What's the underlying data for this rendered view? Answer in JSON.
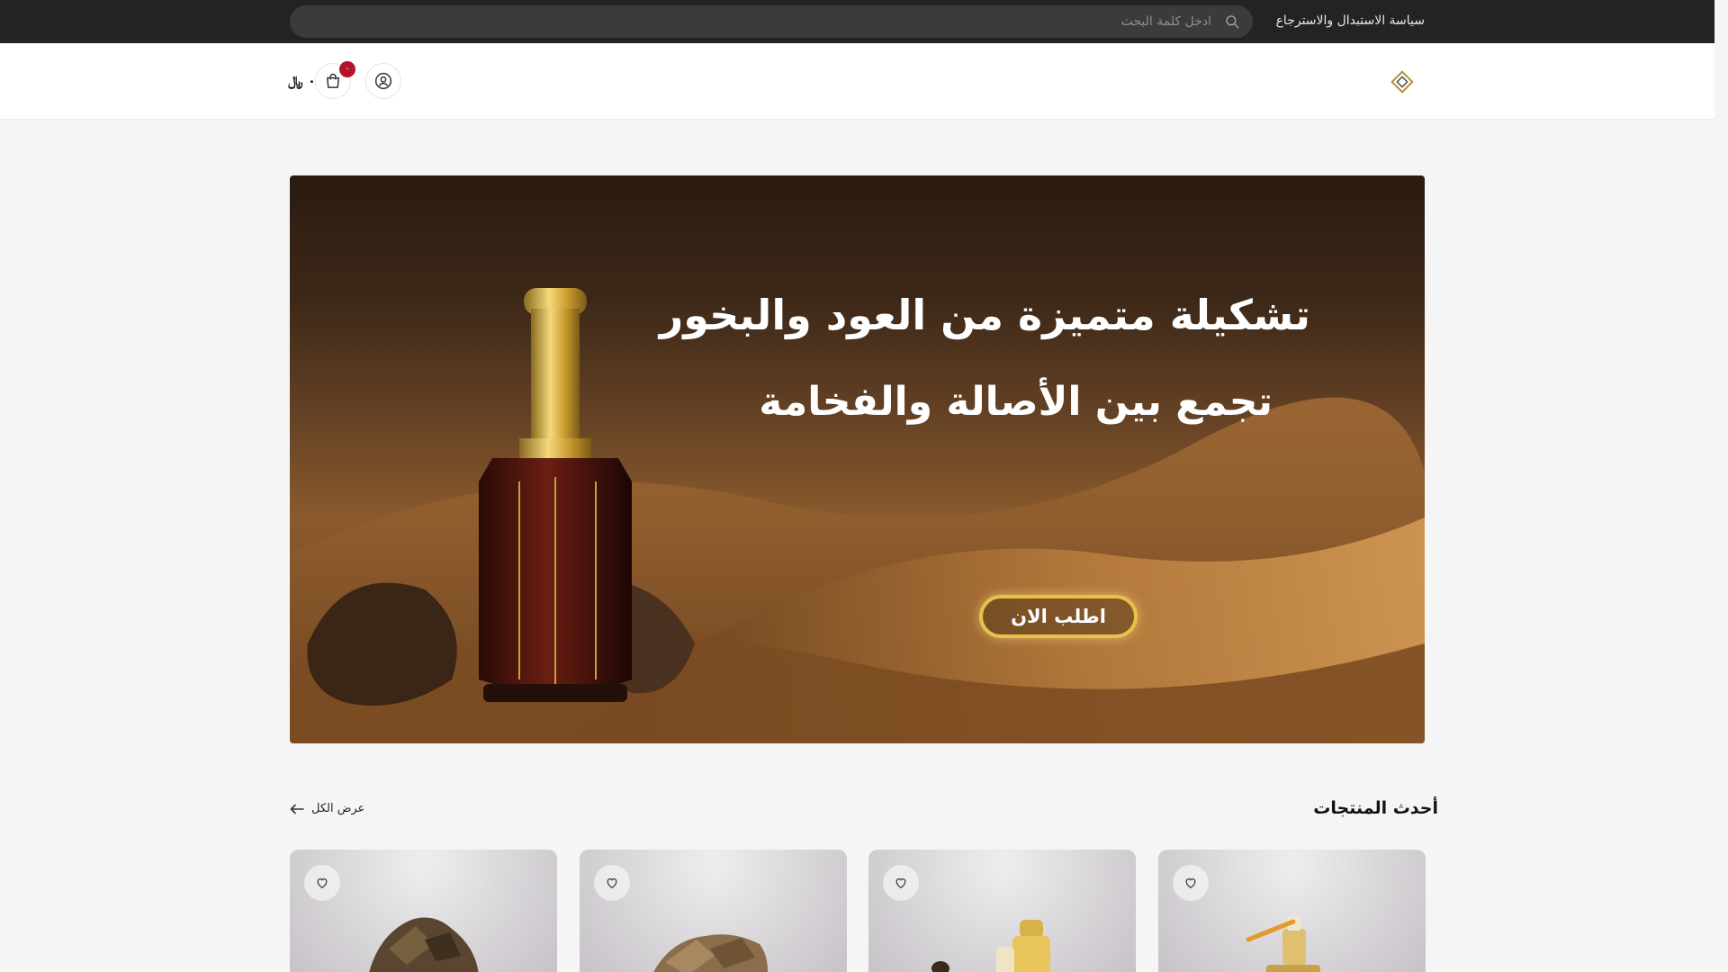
{
  "topbar": {
    "policy_link": "سياسة الاستبدال والاسترجاع",
    "search_placeholder": "ادخل كلمة البحث"
  },
  "header": {
    "cart_count": "٠",
    "cart_total": "٠ ﷼"
  },
  "banner": {
    "line1": "تشكيلة متميزة من العود والبخور",
    "line2": "تجمع بين الأصالة والفخامة",
    "cta": "اطلب الان"
  },
  "latest": {
    "title": "أحدث المنتجات",
    "view_all": "عرض الكل"
  },
  "colors": {
    "topbar_bg": "#232323",
    "badge": "#b3142b",
    "cta_border": "#e8c14a"
  },
  "icons": [
    "search-icon",
    "logo-icon",
    "user-icon",
    "shopping-bag-icon",
    "arrow-left-icon",
    "heart-icon"
  ]
}
